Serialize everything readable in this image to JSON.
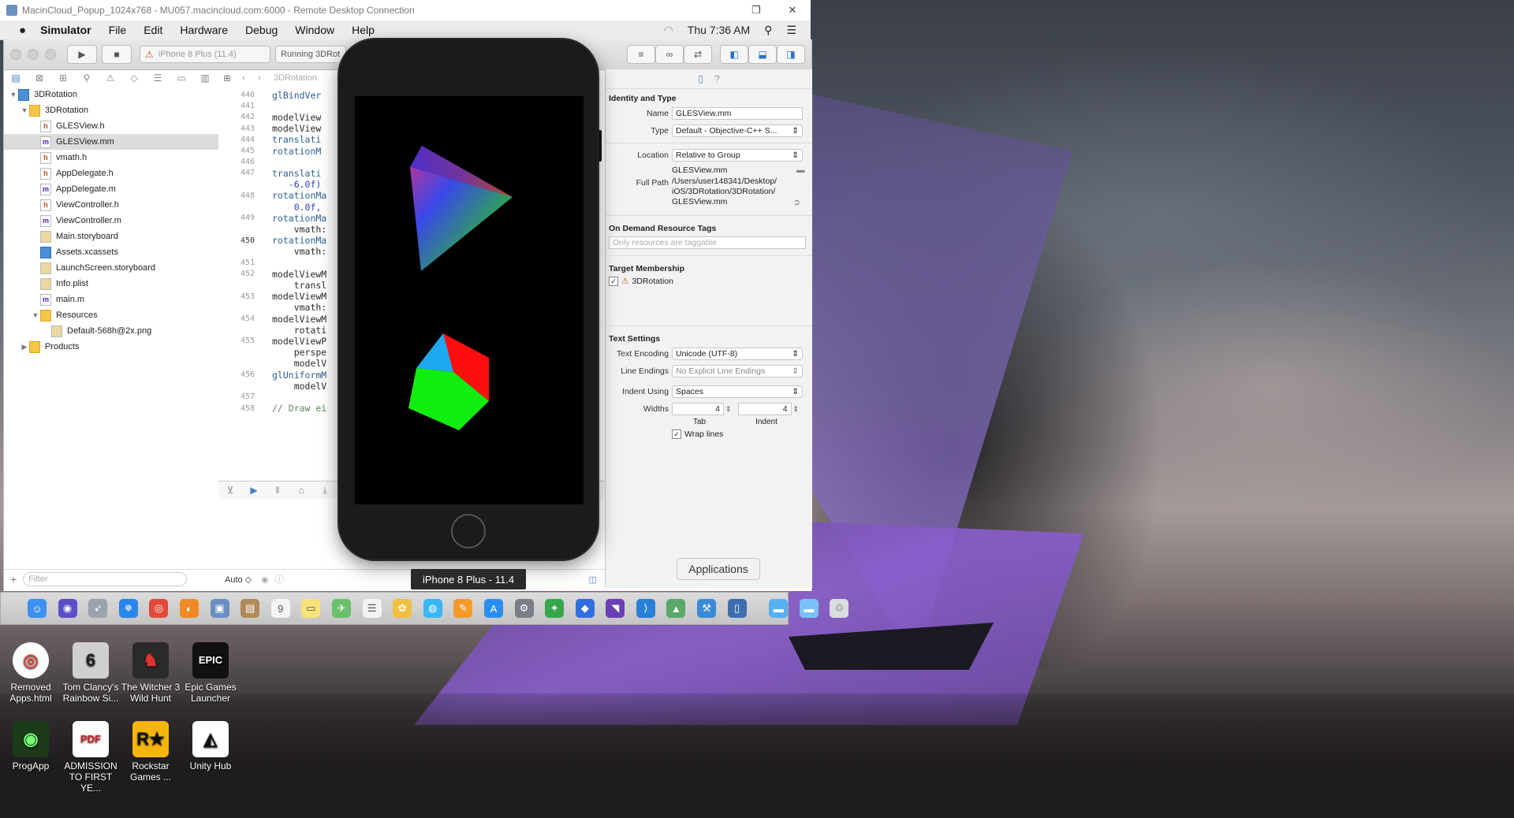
{
  "window": {
    "rdp_title": "MacinCloud_Popup_1024x768 - MU057.macincloud.com:6000 - Remote Desktop Connection",
    "restore_glyph": "❐",
    "close_glyph": "✕"
  },
  "menubar": {
    "app": "Simulator",
    "items": [
      "File",
      "Edit",
      "Hardware",
      "Debug",
      "Window",
      "Help"
    ],
    "clock": "Thu 7:36 AM"
  },
  "toolbar": {
    "scheme": "iPhone 8 Plus (11.4)",
    "status": "Running 3DRot"
  },
  "navigator": {
    "items": [
      {
        "label": "3DRotation",
        "kind": "project",
        "indent": 0,
        "open": true
      },
      {
        "label": "3DRotation",
        "kind": "folder",
        "indent": 1,
        "open": true
      },
      {
        "label": "GLESView.h",
        "kind": "h",
        "indent": 2
      },
      {
        "label": "GLESView.mm",
        "kind": "m",
        "indent": 2,
        "selected": true
      },
      {
        "label": "vmath.h",
        "kind": "h",
        "indent": 2
      },
      {
        "label": "AppDelegate.h",
        "kind": "h",
        "indent": 2
      },
      {
        "label": "AppDelegate.m",
        "kind": "m",
        "indent": 2
      },
      {
        "label": "ViewController.h",
        "kind": "h",
        "indent": 2
      },
      {
        "label": "ViewController.m",
        "kind": "m",
        "indent": 2
      },
      {
        "label": "Main.storyboard",
        "kind": "sb",
        "indent": 2
      },
      {
        "label": "Assets.xcassets",
        "kind": "blue",
        "indent": 2
      },
      {
        "label": "LaunchScreen.storyboard",
        "kind": "sb",
        "indent": 2
      },
      {
        "label": "Info.plist",
        "kind": "sb",
        "indent": 2
      },
      {
        "label": "main.m",
        "kind": "m",
        "indent": 2
      },
      {
        "label": "Resources",
        "kind": "folder",
        "indent": 2,
        "open": true
      },
      {
        "label": "Default-568h@2x.png",
        "kind": "sb",
        "indent": 3
      },
      {
        "label": "Products",
        "kind": "folder",
        "indent": 1,
        "open": false
      }
    ],
    "filter_placeholder": "Filter"
  },
  "editor": {
    "jump": "3DRotation",
    "lines": [
      {
        "n": "440",
        "code": "glBindVer",
        "y": 0
      },
      {
        "n": "441",
        "code": "",
        "y": 1
      },
      {
        "n": "442",
        "code": "modelView",
        "y": 2
      },
      {
        "n": "443",
        "code": "modelView",
        "y": 3
      },
      {
        "n": "444",
        "code": "translati",
        "y": 4
      },
      {
        "n": "445",
        "code": "rotationM",
        "y": 5
      },
      {
        "n": "446",
        "code": "",
        "y": 6
      },
      {
        "n": "447",
        "code": "translati",
        "y": 7
      },
      {
        "n": "",
        "code": "   -6.0f)",
        "y": 8
      },
      {
        "n": "448",
        "code": "rotationMa",
        "y": 9
      },
      {
        "n": "",
        "code": "    0.0f,",
        "y": 10
      },
      {
        "n": "449",
        "code": "rotationMa",
        "y": 11
      },
      {
        "n": "",
        "code": "    vmath:",
        "y": 12
      },
      {
        "n": "450",
        "code": "rotationMa",
        "y": 13,
        "current": true
      },
      {
        "n": "",
        "code": "    vmath:",
        "y": 14
      },
      {
        "n": "451",
        "code": "",
        "y": 15
      },
      {
        "n": "452",
        "code": "modelViewM",
        "y": 16
      },
      {
        "n": "",
        "code": "    transl",
        "y": 17
      },
      {
        "n": "453",
        "code": "modelViewM",
        "y": 18
      },
      {
        "n": "",
        "code": "    vmath:",
        "y": 19
      },
      {
        "n": "454",
        "code": "modelViewM",
        "y": 20
      },
      {
        "n": "",
        "code": "    rotati",
        "y": 21
      },
      {
        "n": "455",
        "code": "modelViewP",
        "y": 22
      },
      {
        "n": "",
        "code": "    perspe",
        "y": 23
      },
      {
        "n": "",
        "code": "    modelV",
        "y": 24
      },
      {
        "n": "456",
        "code": "glUniformM",
        "y": 25
      },
      {
        "n": "",
        "code": "    modelV",
        "y": 26
      },
      {
        "n": "457",
        "code": "",
        "y": 27
      },
      {
        "n": "458",
        "code": "// Draw ei",
        "y": 28
      }
    ],
    "auto_label": "Auto ◇"
  },
  "inspector": {
    "identity_title": "Identity and Type",
    "name_label": "Name",
    "name_value": "GLESView.mm",
    "type_label": "Type",
    "type_value": "Default - Objective-C++ S...",
    "location_label": "Location",
    "location_value": "Relative to Group",
    "location_file": "GLESView.mm",
    "fullpath_label": "Full Path",
    "fullpath_value": "/Users/user148341/Desktop/ iOS/3DRotation/3DRotation/ GLESView.mm",
    "ondemand_title": "On Demand Resource Tags",
    "ondemand_placeholder": "Only resources are taggable",
    "target_title": "Target Membership",
    "target_item": "3DRotation",
    "text_title": "Text Settings",
    "encoding_label": "Text Encoding",
    "encoding_value": "Unicode (UTF-8)",
    "endings_label": "Line Endings",
    "endings_value": "No Explicit Line Endings",
    "indent_label": "Indent Using",
    "indent_value": "Spaces",
    "widths_label": "Widths",
    "tab_value": "4",
    "indent_width_value": "4",
    "tab_caption": "Tab",
    "indent_caption": "Indent",
    "wrap_label": "Wrap lines"
  },
  "simulator": {
    "label": "iPhone 8 Plus - 11.4"
  },
  "tooltip": "Applications",
  "dock": {
    "icons": [
      {
        "name": "finder-icon",
        "color": "#3d8ff0",
        "glyph": "☺"
      },
      {
        "name": "siri-icon",
        "color": "#5a4fc8",
        "glyph": "◉"
      },
      {
        "name": "launchpad-icon",
        "color": "#9aa2ad",
        "glyph": "➶"
      },
      {
        "name": "safari-icon",
        "color": "#2a86e8",
        "glyph": "✵"
      },
      {
        "name": "chrome-icon",
        "color": "#e04a3b",
        "glyph": "◎"
      },
      {
        "name": "firefox-icon",
        "color": "#f08a24",
        "glyph": "◐"
      },
      {
        "name": "preview-icon",
        "color": "#6a8fc0",
        "glyph": "▣"
      },
      {
        "name": "notes-brown-icon",
        "color": "#b08a5a",
        "glyph": "▤"
      },
      {
        "name": "calendar-icon",
        "color": "#f4f4f4",
        "glyph": "9"
      },
      {
        "name": "stickies-icon",
        "color": "#f7e37a",
        "glyph": "▭"
      },
      {
        "name": "maps-icon",
        "color": "#6cc06c",
        "glyph": "✈"
      },
      {
        "name": "reminders-icon",
        "color": "#f2f2f2",
        "glyph": "☰"
      },
      {
        "name": "photos-icon",
        "color": "#f0c040",
        "glyph": "✿"
      },
      {
        "name": "messages-icon",
        "color": "#38b6f5",
        "glyph": "◍"
      },
      {
        "name": "books-icon",
        "color": "#f39a2a",
        "glyph": "✎"
      },
      {
        "name": "appstore-icon",
        "color": "#2a8ef0",
        "glyph": "A"
      },
      {
        "name": "system-prefs-icon",
        "color": "#7a7f87",
        "glyph": "⚙"
      },
      {
        "name": "evernote-icon",
        "color": "#37a64a",
        "glyph": "✦"
      },
      {
        "name": "dropbox-icon",
        "color": "#2f6fe0",
        "glyph": "◆"
      },
      {
        "name": "visual-studio-icon",
        "color": "#6a3fb4",
        "glyph": "◥"
      },
      {
        "name": "vscode-icon",
        "color": "#2a7fd6",
        "glyph": "⟩"
      },
      {
        "name": "android-studio-icon",
        "color": "#5aa86a",
        "glyph": "▲"
      },
      {
        "name": "xcode-icon",
        "color": "#3a8ad8",
        "glyph": "⚒"
      },
      {
        "name": "simulator-icon",
        "color": "#3c6fb0",
        "glyph": "▯"
      },
      {
        "name": "applications-folder-icon",
        "color": "#58b0f0",
        "glyph": "▬"
      },
      {
        "name": "downloads-folder-icon",
        "color": "#7ac2f4",
        "glyph": "▬"
      },
      {
        "name": "trash-icon",
        "color": "#d8dde2",
        "glyph": "♲"
      }
    ]
  },
  "desktop": {
    "icons": [
      {
        "name": "chrome-shortcut",
        "label1": "Removed",
        "label2": "Apps.html",
        "col": 0,
        "row": 0,
        "bg": "#ffffff",
        "fg": "#e04a3b",
        "glyph": "◎"
      },
      {
        "name": "rainbow-six-shortcut",
        "label1": "Tom Clancy's",
        "label2": "Rainbow Si...",
        "col": 1,
        "row": 0,
        "bg": "#cfcfcf",
        "fg": "#222",
        "glyph": "6"
      },
      {
        "name": "witcher-shortcut",
        "label1": "The Witcher 3",
        "label2": "Wild Hunt",
        "col": 2,
        "row": 0,
        "bg": "#2a2a2a",
        "fg": "#d33",
        "glyph": "♞"
      },
      {
        "name": "epic-shortcut",
        "label1": "Epic Games",
        "label2": "Launcher",
        "col": 3,
        "row": 0,
        "bg": "#111",
        "fg": "#fff",
        "glyph": "EPIC"
      },
      {
        "name": "progapp-shortcut",
        "label1": "ProgApp",
        "label2": "",
        "col": 0,
        "row": 1,
        "bg": "#1b3b1b",
        "fg": "#7f7",
        "glyph": "◉"
      },
      {
        "name": "pdf-shortcut",
        "label1": "ADMISSION",
        "label2": "TO FIRST YE...",
        "col": 1,
        "row": 1,
        "bg": "#ffffff",
        "fg": "#d22",
        "glyph": "PDF"
      },
      {
        "name": "rockstar-shortcut",
        "label1": "Rockstar",
        "label2": "Games ...",
        "col": 2,
        "row": 1,
        "bg": "#f5b50a",
        "fg": "#111",
        "glyph": "R★"
      },
      {
        "name": "unityhub-shortcut",
        "label1": "Unity Hub",
        "label2": "",
        "col": 3,
        "row": 1,
        "bg": "#ffffff",
        "fg": "#111",
        "glyph": "◭"
      }
    ]
  }
}
